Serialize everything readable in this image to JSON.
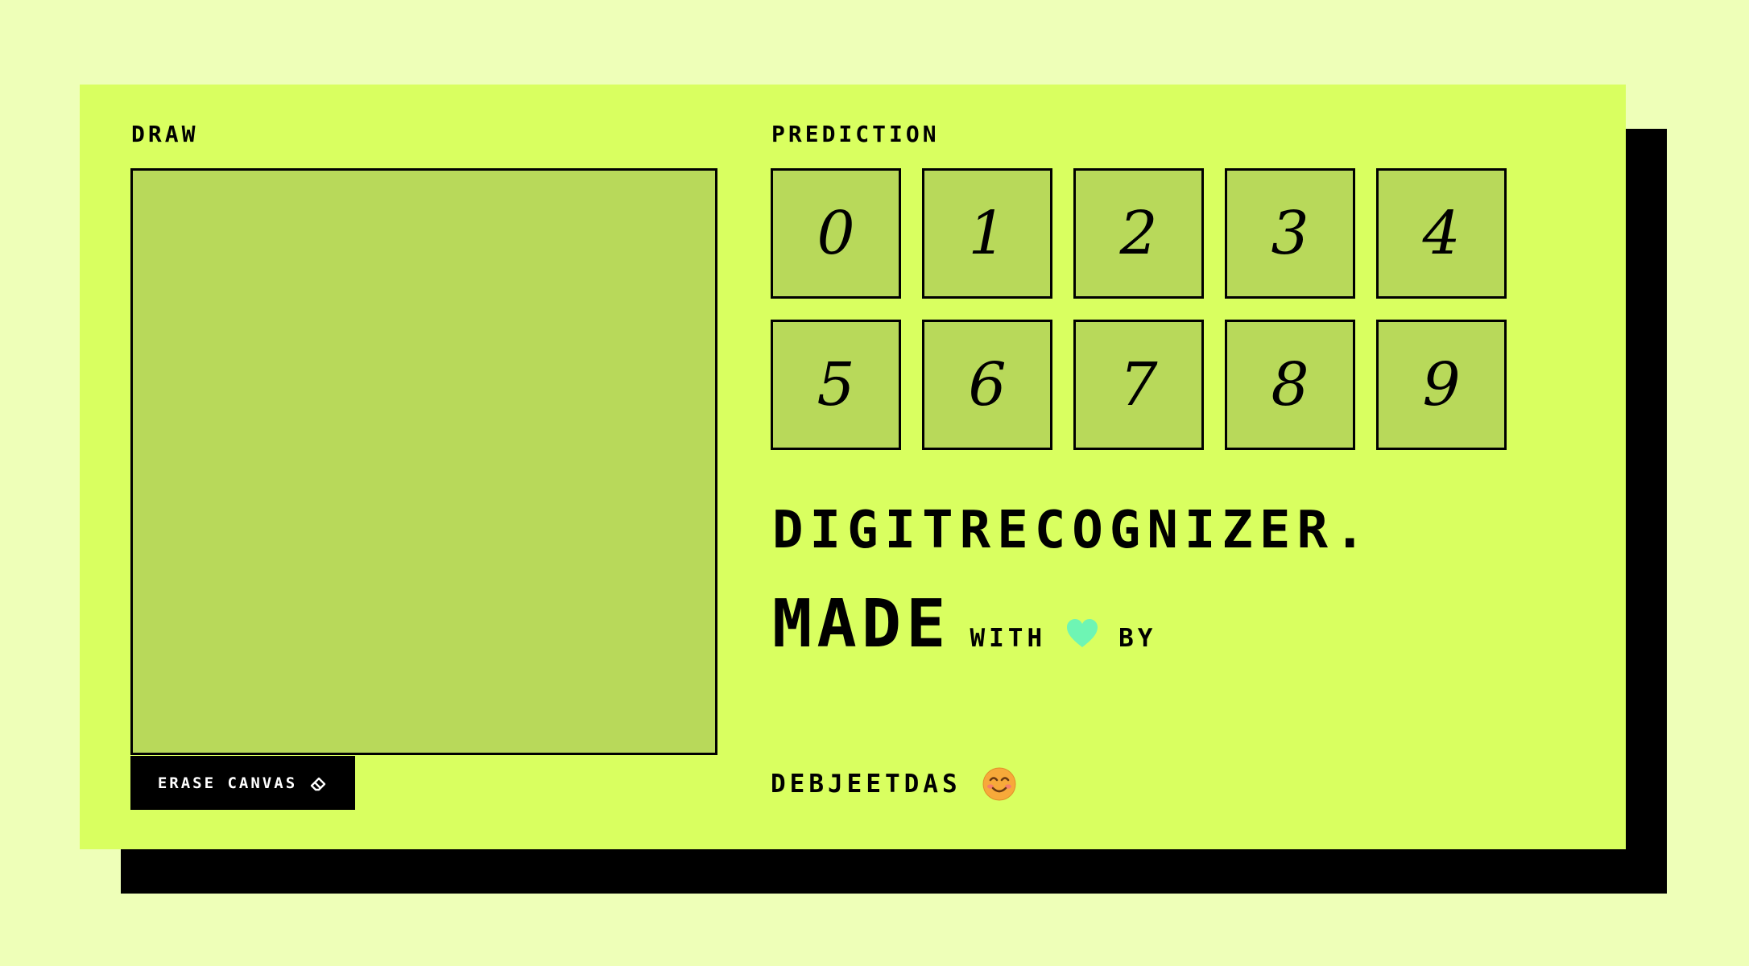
{
  "draw": {
    "label": "DRAW",
    "erase_label": "ERASE CANVAS"
  },
  "prediction": {
    "label": "PREDICTION",
    "digits": [
      "0",
      "1",
      "2",
      "3",
      "4",
      "5",
      "6",
      "7",
      "8",
      "9"
    ]
  },
  "branding": {
    "title": "DIGITRECOGNIZER.",
    "made": "MADE",
    "with": "WITH",
    "by": "BY",
    "author": "DEBJEETDAS"
  },
  "icons": {
    "erase": "eraser-icon",
    "heart": "heart-icon",
    "emoji": "smiling-face-icon"
  },
  "colors": {
    "background": "#eeffb8",
    "card": "#d9ff60",
    "canvas": "#b8d95a",
    "shadow": "#000000",
    "heart": "#6ef5b4",
    "emoji": "#f7a93a"
  }
}
